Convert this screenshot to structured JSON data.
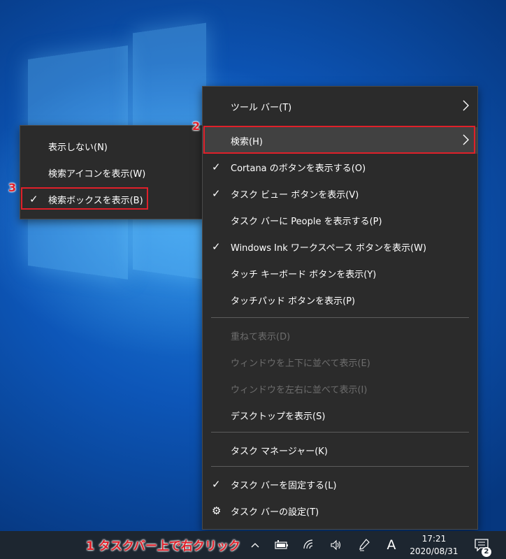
{
  "main_menu": {
    "items": [
      {
        "label": "ツール バー(T)",
        "checked": false,
        "submenu": true,
        "disabled": false,
        "icon": null
      },
      {
        "label": "検索(H)",
        "checked": false,
        "submenu": true,
        "disabled": false,
        "icon": null
      },
      {
        "label": "Cortana のボタンを表示する(O)",
        "checked": true,
        "submenu": false,
        "disabled": false,
        "icon": null
      },
      {
        "label": "タスク ビュー ボタンを表示(V)",
        "checked": true,
        "submenu": false,
        "disabled": false,
        "icon": null
      },
      {
        "label": "タスク バーに People を表示する(P)",
        "checked": false,
        "submenu": false,
        "disabled": false,
        "icon": null
      },
      {
        "label": "Windows Ink ワークスペース ボタンを表示(W)",
        "checked": true,
        "submenu": false,
        "disabled": false,
        "icon": null
      },
      {
        "label": "タッチ キーボード ボタンを表示(Y)",
        "checked": false,
        "submenu": false,
        "disabled": false,
        "icon": null
      },
      {
        "label": "タッチパッド ボタンを表示(P)",
        "checked": false,
        "submenu": false,
        "disabled": false,
        "icon": null
      },
      {
        "label": "重ねて表示(D)",
        "checked": false,
        "submenu": false,
        "disabled": true,
        "icon": null
      },
      {
        "label": "ウィンドウを上下に並べて表示(E)",
        "checked": false,
        "submenu": false,
        "disabled": true,
        "icon": null
      },
      {
        "label": "ウィンドウを左右に並べて表示(I)",
        "checked": false,
        "submenu": false,
        "disabled": true,
        "icon": null
      },
      {
        "label": "デスクトップを表示(S)",
        "checked": false,
        "submenu": false,
        "disabled": false,
        "icon": null
      },
      {
        "label": "タスク マネージャー(K)",
        "checked": false,
        "submenu": false,
        "disabled": false,
        "icon": null
      },
      {
        "label": "タスク バーを固定する(L)",
        "checked": true,
        "submenu": false,
        "disabled": false,
        "icon": null
      },
      {
        "label": "タスク バーの設定(T)",
        "checked": false,
        "submenu": false,
        "disabled": false,
        "icon": "gear-icon"
      }
    ]
  },
  "search_submenu": {
    "items": [
      {
        "label": "表示しない(N)",
        "checked": false
      },
      {
        "label": "検索アイコンを表示(W)",
        "checked": false
      },
      {
        "label": "検索ボックスを表示(B)",
        "checked": true
      }
    ]
  },
  "annotations": {
    "step1": "1 タスクバー上で右クリック",
    "step2": "2",
    "step3": "3"
  },
  "taskbar": {
    "ime_label": "A",
    "time": "17:21",
    "date": "2020/08/31",
    "notification_count": "2",
    "tray_icons": [
      "chevron-up-icon",
      "battery-icon",
      "wifi-icon",
      "volume-icon",
      "pen-icon"
    ]
  },
  "colors": {
    "menu_bg": "#2b2b2b",
    "highlight_box": "#e0202a",
    "taskbar_bg": "#1d2630"
  }
}
